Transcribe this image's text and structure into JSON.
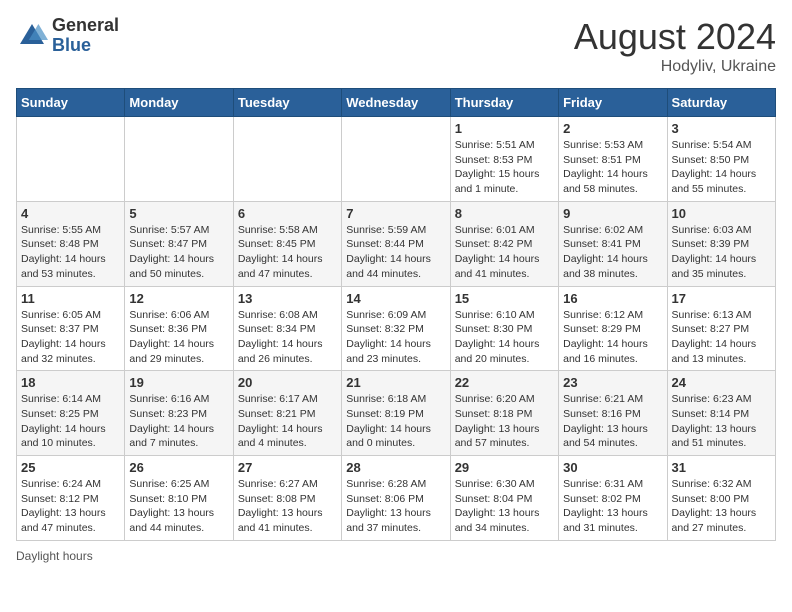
{
  "header": {
    "logo_general": "General",
    "logo_blue": "Blue",
    "month_year": "August 2024",
    "location": "Hodyliv, Ukraine"
  },
  "days_of_week": [
    "Sunday",
    "Monday",
    "Tuesday",
    "Wednesday",
    "Thursday",
    "Friday",
    "Saturday"
  ],
  "weeks": [
    [
      {
        "day": "",
        "info": ""
      },
      {
        "day": "",
        "info": ""
      },
      {
        "day": "",
        "info": ""
      },
      {
        "day": "",
        "info": ""
      },
      {
        "day": "1",
        "info": "Sunrise: 5:51 AM\nSunset: 8:53 PM\nDaylight: 15 hours and 1 minute."
      },
      {
        "day": "2",
        "info": "Sunrise: 5:53 AM\nSunset: 8:51 PM\nDaylight: 14 hours and 58 minutes."
      },
      {
        "day": "3",
        "info": "Sunrise: 5:54 AM\nSunset: 8:50 PM\nDaylight: 14 hours and 55 minutes."
      }
    ],
    [
      {
        "day": "4",
        "info": "Sunrise: 5:55 AM\nSunset: 8:48 PM\nDaylight: 14 hours and 53 minutes."
      },
      {
        "day": "5",
        "info": "Sunrise: 5:57 AM\nSunset: 8:47 PM\nDaylight: 14 hours and 50 minutes."
      },
      {
        "day": "6",
        "info": "Sunrise: 5:58 AM\nSunset: 8:45 PM\nDaylight: 14 hours and 47 minutes."
      },
      {
        "day": "7",
        "info": "Sunrise: 5:59 AM\nSunset: 8:44 PM\nDaylight: 14 hours and 44 minutes."
      },
      {
        "day": "8",
        "info": "Sunrise: 6:01 AM\nSunset: 8:42 PM\nDaylight: 14 hours and 41 minutes."
      },
      {
        "day": "9",
        "info": "Sunrise: 6:02 AM\nSunset: 8:41 PM\nDaylight: 14 hours and 38 minutes."
      },
      {
        "day": "10",
        "info": "Sunrise: 6:03 AM\nSunset: 8:39 PM\nDaylight: 14 hours and 35 minutes."
      }
    ],
    [
      {
        "day": "11",
        "info": "Sunrise: 6:05 AM\nSunset: 8:37 PM\nDaylight: 14 hours and 32 minutes."
      },
      {
        "day": "12",
        "info": "Sunrise: 6:06 AM\nSunset: 8:36 PM\nDaylight: 14 hours and 29 minutes."
      },
      {
        "day": "13",
        "info": "Sunrise: 6:08 AM\nSunset: 8:34 PM\nDaylight: 14 hours and 26 minutes."
      },
      {
        "day": "14",
        "info": "Sunrise: 6:09 AM\nSunset: 8:32 PM\nDaylight: 14 hours and 23 minutes."
      },
      {
        "day": "15",
        "info": "Sunrise: 6:10 AM\nSunset: 8:30 PM\nDaylight: 14 hours and 20 minutes."
      },
      {
        "day": "16",
        "info": "Sunrise: 6:12 AM\nSunset: 8:29 PM\nDaylight: 14 hours and 16 minutes."
      },
      {
        "day": "17",
        "info": "Sunrise: 6:13 AM\nSunset: 8:27 PM\nDaylight: 14 hours and 13 minutes."
      }
    ],
    [
      {
        "day": "18",
        "info": "Sunrise: 6:14 AM\nSunset: 8:25 PM\nDaylight: 14 hours and 10 minutes."
      },
      {
        "day": "19",
        "info": "Sunrise: 6:16 AM\nSunset: 8:23 PM\nDaylight: 14 hours and 7 minutes."
      },
      {
        "day": "20",
        "info": "Sunrise: 6:17 AM\nSunset: 8:21 PM\nDaylight: 14 hours and 4 minutes."
      },
      {
        "day": "21",
        "info": "Sunrise: 6:18 AM\nSunset: 8:19 PM\nDaylight: 14 hours and 0 minutes."
      },
      {
        "day": "22",
        "info": "Sunrise: 6:20 AM\nSunset: 8:18 PM\nDaylight: 13 hours and 57 minutes."
      },
      {
        "day": "23",
        "info": "Sunrise: 6:21 AM\nSunset: 8:16 PM\nDaylight: 13 hours and 54 minutes."
      },
      {
        "day": "24",
        "info": "Sunrise: 6:23 AM\nSunset: 8:14 PM\nDaylight: 13 hours and 51 minutes."
      }
    ],
    [
      {
        "day": "25",
        "info": "Sunrise: 6:24 AM\nSunset: 8:12 PM\nDaylight: 13 hours and 47 minutes."
      },
      {
        "day": "26",
        "info": "Sunrise: 6:25 AM\nSunset: 8:10 PM\nDaylight: 13 hours and 44 minutes."
      },
      {
        "day": "27",
        "info": "Sunrise: 6:27 AM\nSunset: 8:08 PM\nDaylight: 13 hours and 41 minutes."
      },
      {
        "day": "28",
        "info": "Sunrise: 6:28 AM\nSunset: 8:06 PM\nDaylight: 13 hours and 37 minutes."
      },
      {
        "day": "29",
        "info": "Sunrise: 6:30 AM\nSunset: 8:04 PM\nDaylight: 13 hours and 34 minutes."
      },
      {
        "day": "30",
        "info": "Sunrise: 6:31 AM\nSunset: 8:02 PM\nDaylight: 13 hours and 31 minutes."
      },
      {
        "day": "31",
        "info": "Sunrise: 6:32 AM\nSunset: 8:00 PM\nDaylight: 13 hours and 27 minutes."
      }
    ]
  ],
  "footer": {
    "note": "Daylight hours"
  }
}
